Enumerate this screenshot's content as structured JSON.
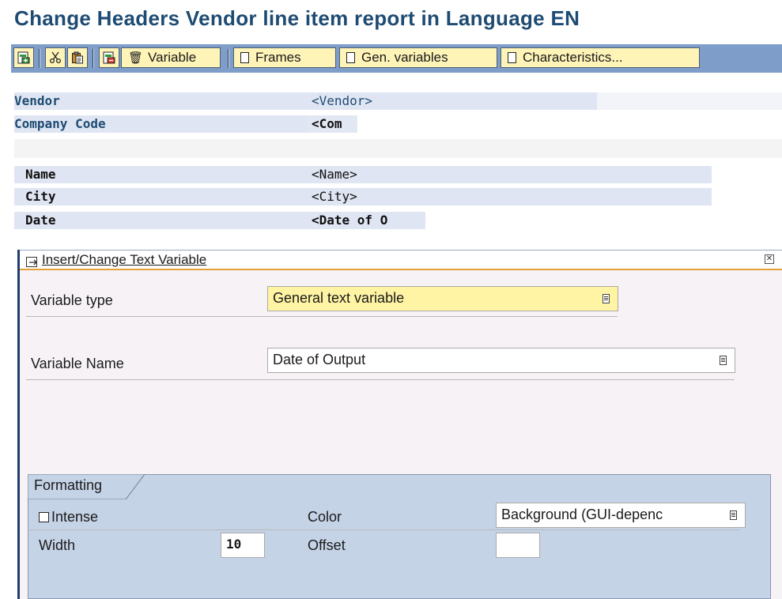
{
  "window": {
    "title": "Change Headers Vendor line item report in Language EN"
  },
  "toolbar": {
    "icons": [
      "insert-row-icon",
      "cut-icon",
      "paste-icon",
      "delete-row-icon"
    ],
    "variable_label": "Variable",
    "frames_label": "Frames",
    "gen_variables_label": "Gen. variables",
    "characteristics_label": "Characteristics..."
  },
  "header_rows": [
    {
      "label": "Vendor",
      "value": "<Vendor>"
    },
    {
      "label": "Company Code",
      "value": "<Com"
    },
    {
      "label": "Name",
      "value": "<Name>"
    },
    {
      "label": "City",
      "value": "<City>"
    },
    {
      "label": "Date",
      "value": "<Date of O"
    }
  ],
  "dialog": {
    "title": "Insert/Change Text Variable",
    "variable_type_label": "Variable type",
    "variable_type_value": "General text variable",
    "variable_name_label": "Variable Name",
    "variable_name_value": "Date of Output",
    "formatting": {
      "tab_label": "Formatting",
      "intense_label": "Intense",
      "intense_checked": false,
      "color_label": "Color",
      "color_value": "Background (GUI-depenc",
      "width_label": "Width",
      "width_value": "10",
      "offset_label": "Offset",
      "offset_value": ""
    }
  },
  "colors": {
    "title_blue": "#1e4b73",
    "toolbar_blue": "#7e9ec9",
    "button_yellow": "#fff4b8",
    "required_field_yellow": "#fff4a3",
    "formatting_panel": "#c5d3e7"
  }
}
